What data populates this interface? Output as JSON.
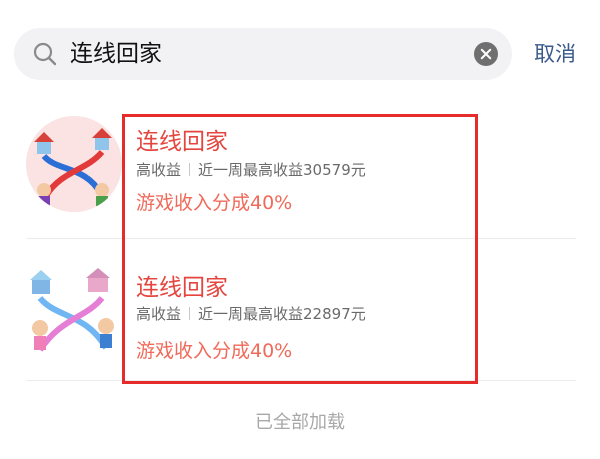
{
  "search": {
    "query": "连线回家",
    "cancel_label": "取消"
  },
  "results": [
    {
      "title": "连线回家",
      "tag": "高收益",
      "stat": "近一周最高收益30579元",
      "revenue": "游戏收入分成40%"
    },
    {
      "title": "连线回家",
      "tag": "高收益",
      "stat": "近一周最高收益22897元",
      "revenue": "游戏收入分成40%"
    }
  ],
  "footer": {
    "status": "已全部加载"
  },
  "colors": {
    "title": "#e4463f",
    "revenue": "#f06a5a",
    "highlight": "#e62b2b",
    "cancel": "#3a5a8c"
  }
}
